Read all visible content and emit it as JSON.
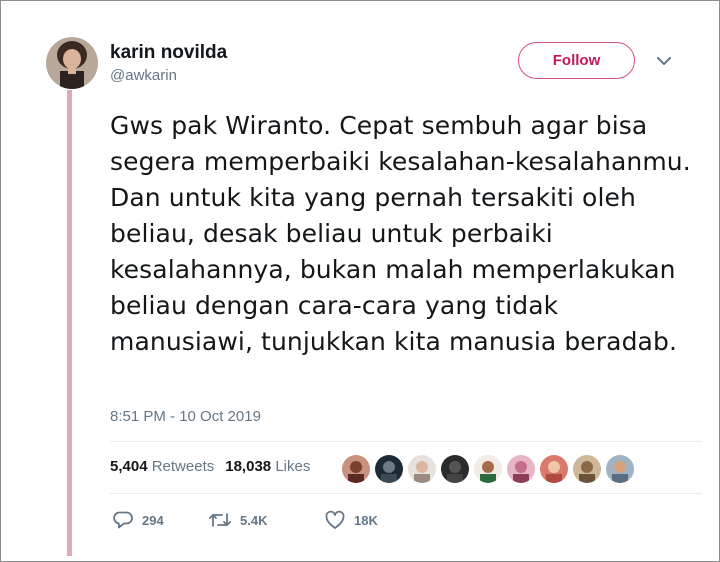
{
  "tweet": {
    "author": {
      "name": "karin novilda",
      "handle": "@awkarin"
    },
    "follow_label": "Follow",
    "text": "Gws pak Wiranto. Cepat sembuh agar bisa segera memperbaiki kesalahan-kesalahanmu. Dan untuk kita yang pernah tersakiti oleh beliau, desak beliau untuk perbaiki kesalahannya, bukan malah memperlakukan beliau dengan cara-cara yang tidak manusiawi, tunjukkan kita manusia beradab.",
    "timestamp": "8:51 PM - 10 Oct 2019",
    "stats": {
      "retweets_count": "5,404",
      "retweets_label": "Retweets",
      "likes_count": "18,038",
      "likes_label": "Likes"
    },
    "actions": {
      "reply_count": "294",
      "retweet_count": "5.4K",
      "like_count": "18K"
    },
    "accent_color": "#c2185b",
    "thread_line_color": "#dfa9bb",
    "icons": [
      "chevron-down-icon",
      "reply-icon",
      "retweet-icon",
      "heart-icon"
    ]
  }
}
